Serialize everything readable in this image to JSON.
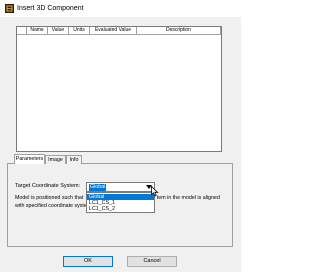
{
  "window": {
    "title": "Insert 3D Component",
    "icon": "app-icon"
  },
  "table": {
    "columns": [
      "",
      "Name",
      "Value",
      "Units",
      "Evaluated Value",
      "Description"
    ]
  },
  "tabs": [
    {
      "label": "Parameters",
      "active": true
    },
    {
      "label": "Image",
      "active": false
    },
    {
      "label": "Info",
      "active": false
    }
  ],
  "coordinate": {
    "label": "Target Coordinate System:",
    "selected": "Global",
    "options": [
      "Global",
      "LC1_CS_1",
      "LC1_CS_2"
    ]
  },
  "description": {
    "line1_left": "Model is positioned such that ",
    "line1_right": "tem in the model is aligned",
    "line2_left": "with specified coordinate syste"
  },
  "buttons": {
    "ok": "OK",
    "cancel": "Cancel"
  },
  "colors": {
    "selection": "#0078d7",
    "dialog_bg": "#f0f0f0"
  }
}
